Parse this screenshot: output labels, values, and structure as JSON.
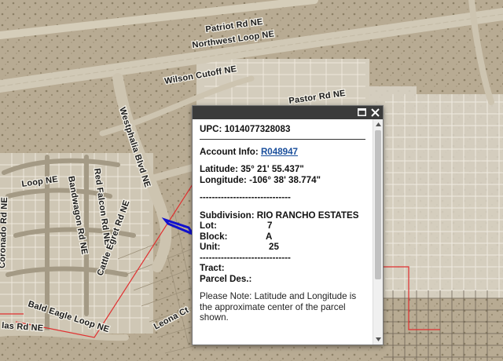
{
  "map": {
    "roads": {
      "patriot": "Patriot Rd NE",
      "northwest_loop": "Northwest Loop NE",
      "wilson_cutoff": "Wilson Cutoff NE",
      "pastor": "Pastor Rd NE",
      "westphalia": "Westphalia Blvd NE",
      "loop_ne": "Loop NE",
      "bandwagon": "Bandwagon Rd NE",
      "red_falcon": "Red Falcon Rd NE",
      "coronado": "Coronado Rd NE",
      "bald_eagle": "Bald Eagle Loop NE",
      "las": "las Rd NE",
      "leona": "Leona Ct",
      "cattle": "Cattle Egret Rd NE"
    },
    "colors": {
      "parcel_lines": "#c8c0b0",
      "subdivision_boundary": "#e03030",
      "selected_parcel": "#1010d0"
    }
  },
  "popup": {
    "buttons": {
      "maximize_icon": "maximize-icon",
      "close_icon": "close-icon"
    },
    "upc_label": "UPC:",
    "upc_value": "1014077328083",
    "account_label": "Account Info:",
    "account_value": "R048947",
    "latitude_label": "Latitude:",
    "latitude_value": "35° 21' 55.437\"",
    "longitude_label": "Longitude:",
    "longitude_value": "-106° 38' 38.774\"",
    "dashes": "------------------------------",
    "subdivision_label": "Subdivision:",
    "subdivision_value": "RIO RANCHO ESTATES",
    "lot_label": "Lot:",
    "lot_value": "7",
    "block_label": "Block:",
    "block_value": "A",
    "unit_label": "Unit:",
    "unit_value": "25",
    "tract_label": "Tract:",
    "parcel_des_label": "Parcel Des.:",
    "note": "Please Note: Latitude and Longitude is the approximate center of the parcel shown."
  }
}
